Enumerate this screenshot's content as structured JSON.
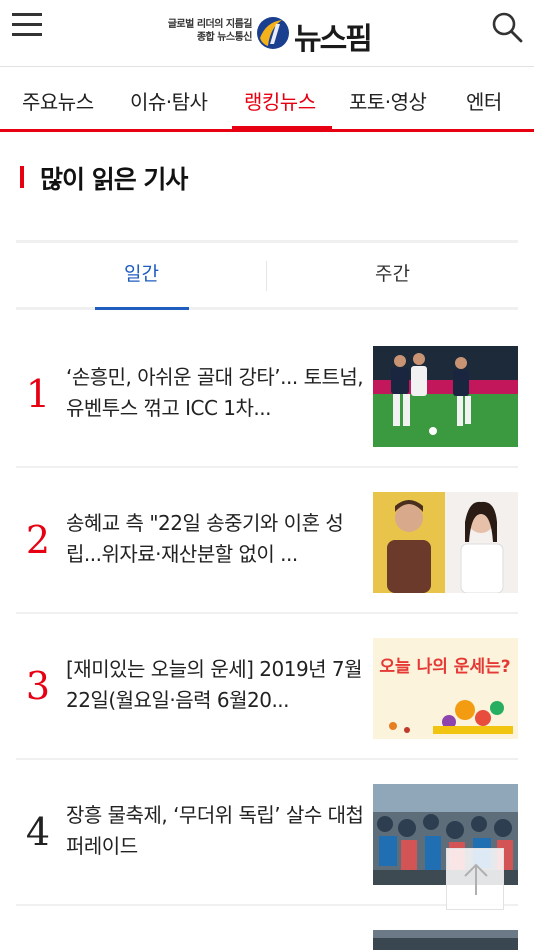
{
  "header": {
    "logo_tag_line1": "글로벌 리더의 지름길",
    "logo_tag_line2": "종합 뉴스통신",
    "logo_text": "뉴스핌",
    "menu_icon": "hamburger-menu-icon",
    "search_icon": "search-icon"
  },
  "nav": {
    "items": [
      {
        "label": "주요뉴스"
      },
      {
        "label": "이슈·탐사"
      },
      {
        "label": "랭킹뉴스"
      },
      {
        "label": "포토·영상"
      },
      {
        "label": "엔터"
      }
    ],
    "active_index": 2
  },
  "section": {
    "title": "많이 읽은 기사"
  },
  "period_tabs": {
    "daily": "일간",
    "weekly": "주간",
    "active": "daily"
  },
  "news": [
    {
      "rank": "1",
      "headline": "‘손흥민, 아쉬운 골대 강타’... 토트넘, 유벤투스 꺾고 ICC 1차..."
    },
    {
      "rank": "2",
      "headline": "송혜교 측 \"22일 송중기와 이혼 성립...위자료·재산분할 없이 ..."
    },
    {
      "rank": "3",
      "headline": "[재미있는 오늘의 운세] 2019년 7월22일(월요일·음력 6월20..."
    },
    {
      "rank": "4",
      "headline": "장흥 물축제, ‘무더위 독립’ 살수 대첩 퍼레이드"
    }
  ],
  "thumb3_text": "오늘 나의 운세는?",
  "colors": {
    "accent_red": "#e60012",
    "accent_blue": "#1f5dbf"
  },
  "top_button_icon": "arrow-up-icon"
}
